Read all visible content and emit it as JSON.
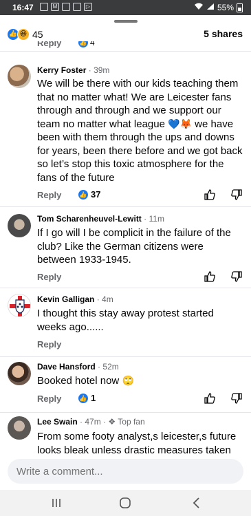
{
  "status_bar": {
    "time": "16:47",
    "battery": "55%"
  },
  "header": {
    "reaction_count": "45",
    "shares": "5 shares"
  },
  "partial_row": {
    "reply": "Reply",
    "likes": "4"
  },
  "comments": [
    {
      "author": "Kerry Foster",
      "time": "39m",
      "text": "We will be there with our kids teaching them that no matter what! We are Leicester fans through and through and we support our team no matter what league",
      "text_after_emoji": "we have been with them through the ups and downs for years, been there before and we got back so let’s stop this toxic atmosphere for the fans of the future",
      "reply": "Reply",
      "likes": "37"
    },
    {
      "author": "Tom Scharenheuvel-Lewitt",
      "time": "11m",
      "text": "If I go will I be complicit in the failure of the club? Like the German citizens were between 1933-1945.",
      "reply": "Reply"
    },
    {
      "author": "Kevin Galligan",
      "time": "4m",
      "text": "I thought this stay away protest started weeks ago......",
      "reply": "Reply"
    },
    {
      "author": "Dave Hansford",
      "time": "52m",
      "text": "Booked hotel now",
      "reply": "Reply",
      "likes": "1"
    },
    {
      "author": "Lee Swain",
      "time": "47m",
      "badge": "Top fan",
      "text": "From some footy analyst,s leicester,s future looks bleak unless drastic measures taken"
    }
  ],
  "composer": {
    "placeholder": "Write a comment..."
  },
  "colors": {
    "accent": "#1877f2",
    "secondary_text": "#65676b"
  }
}
